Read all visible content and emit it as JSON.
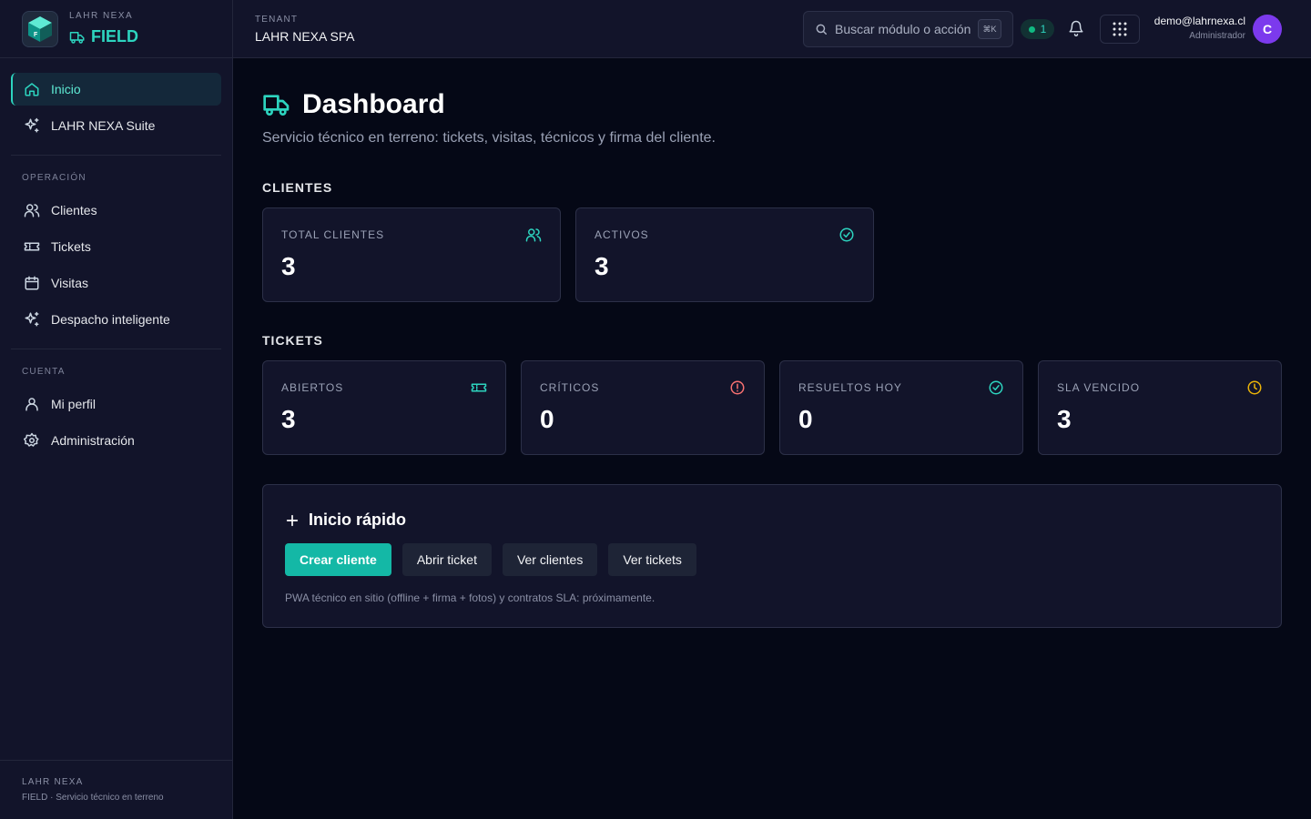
{
  "brand": {
    "org": "LAHR NEXA",
    "product": "FIELD",
    "logo_letter": "F"
  },
  "sidebar": {
    "top_items": [
      {
        "label": "Inicio",
        "icon": "home-icon",
        "active": true
      },
      {
        "label": "LAHR NEXA Suite",
        "icon": "sparkles-icon"
      }
    ],
    "operacion": {
      "title": "OPERACIÓN",
      "items": [
        {
          "label": "Clientes",
          "icon": "users-icon"
        },
        {
          "label": "Tickets",
          "icon": "ticket-icon"
        },
        {
          "label": "Visitas",
          "icon": "calendar-icon"
        },
        {
          "label": "Despacho inteligente",
          "icon": "sparkles-icon"
        }
      ]
    },
    "cuenta": {
      "title": "CUENTA",
      "items": [
        {
          "label": "Mi perfil",
          "icon": "user-icon"
        },
        {
          "label": "Administración",
          "icon": "gear-icon"
        }
      ]
    },
    "footer": {
      "title": "LAHR NEXA",
      "subtitle": "FIELD · Servicio técnico en terreno"
    }
  },
  "header": {
    "tenant_label": "TENANT",
    "tenant_name": "LAHR NEXA SPA",
    "search_placeholder": "Buscar módulo o acción",
    "search_shortcut": "⌘K",
    "status_count": "1",
    "user_email": "demo@lahrnexa.cl",
    "user_role": "Administrador",
    "avatar_initial": "C"
  },
  "main": {
    "title": "Dashboard",
    "subtitle": "Servicio técnico en terreno: tickets, visitas, técnicos y firma del cliente.",
    "clientes": {
      "title": "CLIENTES",
      "cards": [
        {
          "label": "TOTAL CLIENTES",
          "value": "3",
          "icon": "users-icon",
          "color": "#2dd4bf"
        },
        {
          "label": "ACTIVOS",
          "value": "3",
          "icon": "check-circle-icon",
          "color": "#2dd4bf"
        }
      ]
    },
    "tickets": {
      "title": "TICKETS",
      "cards": [
        {
          "label": "ABIERTOS",
          "value": "3",
          "icon": "ticket-icon",
          "color": "#2dd4bf"
        },
        {
          "label": "CRÍTICOS",
          "value": "0",
          "icon": "alert-circle-icon",
          "color": "#f87171"
        },
        {
          "label": "RESUELTOS HOY",
          "value": "0",
          "icon": "check-circle-icon",
          "color": "#2dd4bf"
        },
        {
          "label": "SLA VENCIDO",
          "value": "3",
          "icon": "clock-icon",
          "color": "#eab308"
        }
      ]
    },
    "quick_start": {
      "title": "Inicio rápido",
      "buttons": [
        "Crear cliente",
        "Abrir ticket",
        "Ver clientes",
        "Ver tickets"
      ],
      "note": "PWA técnico en sitio (offline + firma + fotos) y contratos SLA: próximamente."
    }
  },
  "colors": {
    "accent": "#2dd4bf",
    "primary_button": "#14b8a6",
    "danger": "#f87171",
    "warning": "#eab308",
    "avatar": "#7c3aed"
  }
}
